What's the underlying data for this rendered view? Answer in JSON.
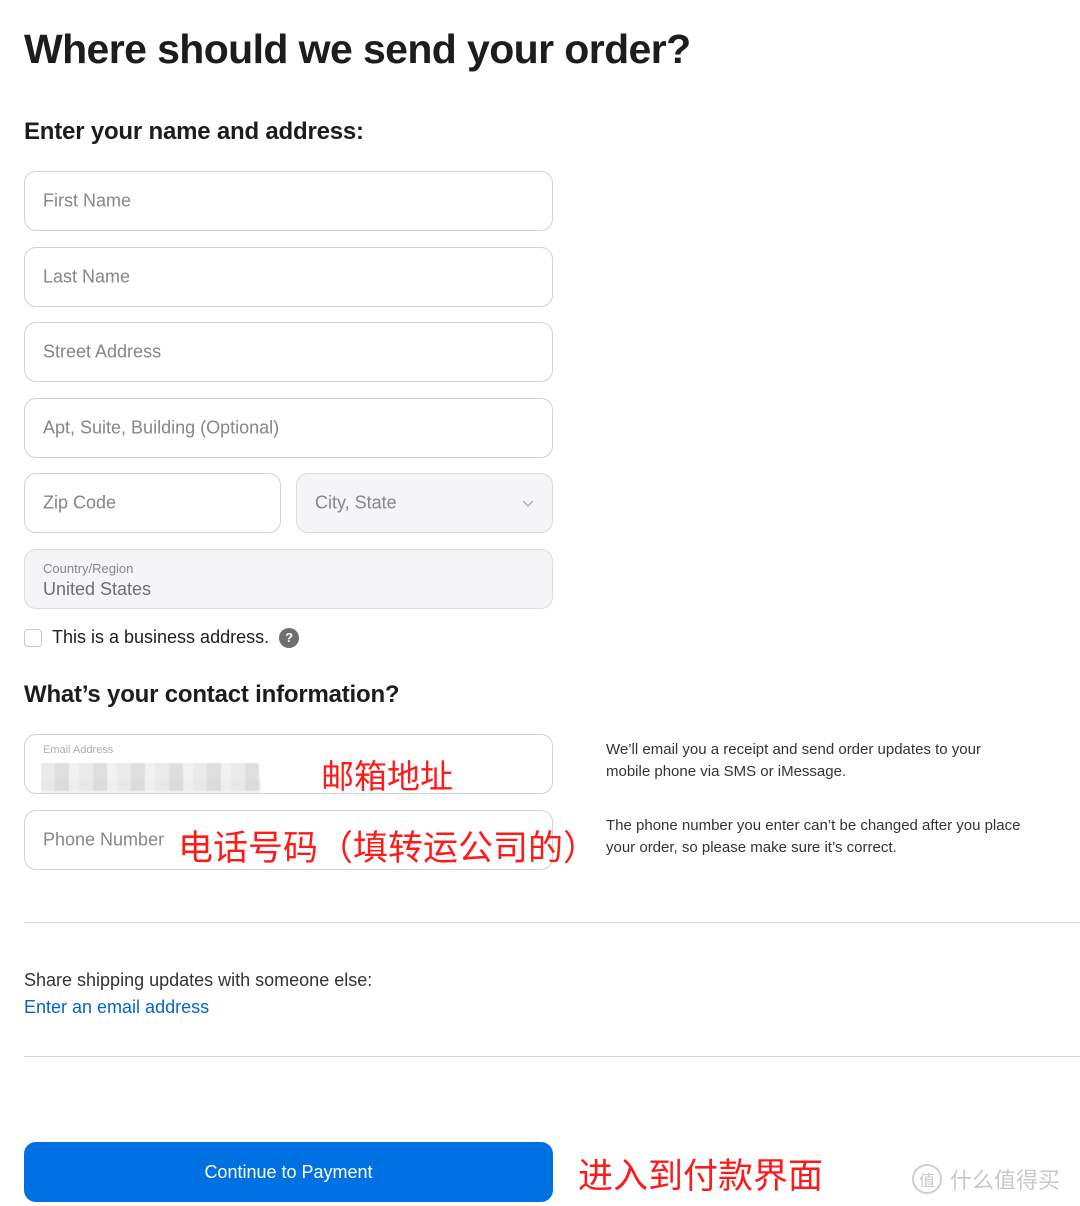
{
  "page": {
    "title": "Where should we send your order?"
  },
  "address_section": {
    "heading": "Enter your name and address:",
    "first_name_placeholder": "First Name",
    "last_name_placeholder": "Last Name",
    "street_placeholder": "Street Address",
    "apt_placeholder": "Apt, Suite, Building (Optional)",
    "zip_placeholder": "Zip Code",
    "city_state_placeholder": "City, State",
    "country_label": "Country/Region",
    "country_value": "United States",
    "business_checkbox_label": "This is a business address.",
    "business_checkbox_checked": false,
    "help_glyph": "?"
  },
  "contact_section": {
    "heading": "What’s your contact information?",
    "email_label": "Email Address",
    "email_value_redacted": true,
    "phone_placeholder": "Phone Number",
    "email_info": "We’ll email you a receipt and send order updates to your mobile phone via SMS or iMessage.",
    "phone_info": "The phone number you enter can’t be changed after you place your order, so please make sure it’s correct."
  },
  "share_section": {
    "label": "Share shipping updates with someone else:",
    "link": "Enter an email address"
  },
  "actions": {
    "continue_label": "Continue to Payment"
  },
  "annotations": {
    "email": "邮箱地址",
    "phone": "电话号码（填转运公司的）",
    "payment": "进入到付款界面"
  },
  "watermark": {
    "icon_glyph": "值",
    "text": "什么值得买"
  },
  "colors": {
    "accent": "#0071e3",
    "link": "#0066cc",
    "annotation": "#ff1a1a"
  }
}
